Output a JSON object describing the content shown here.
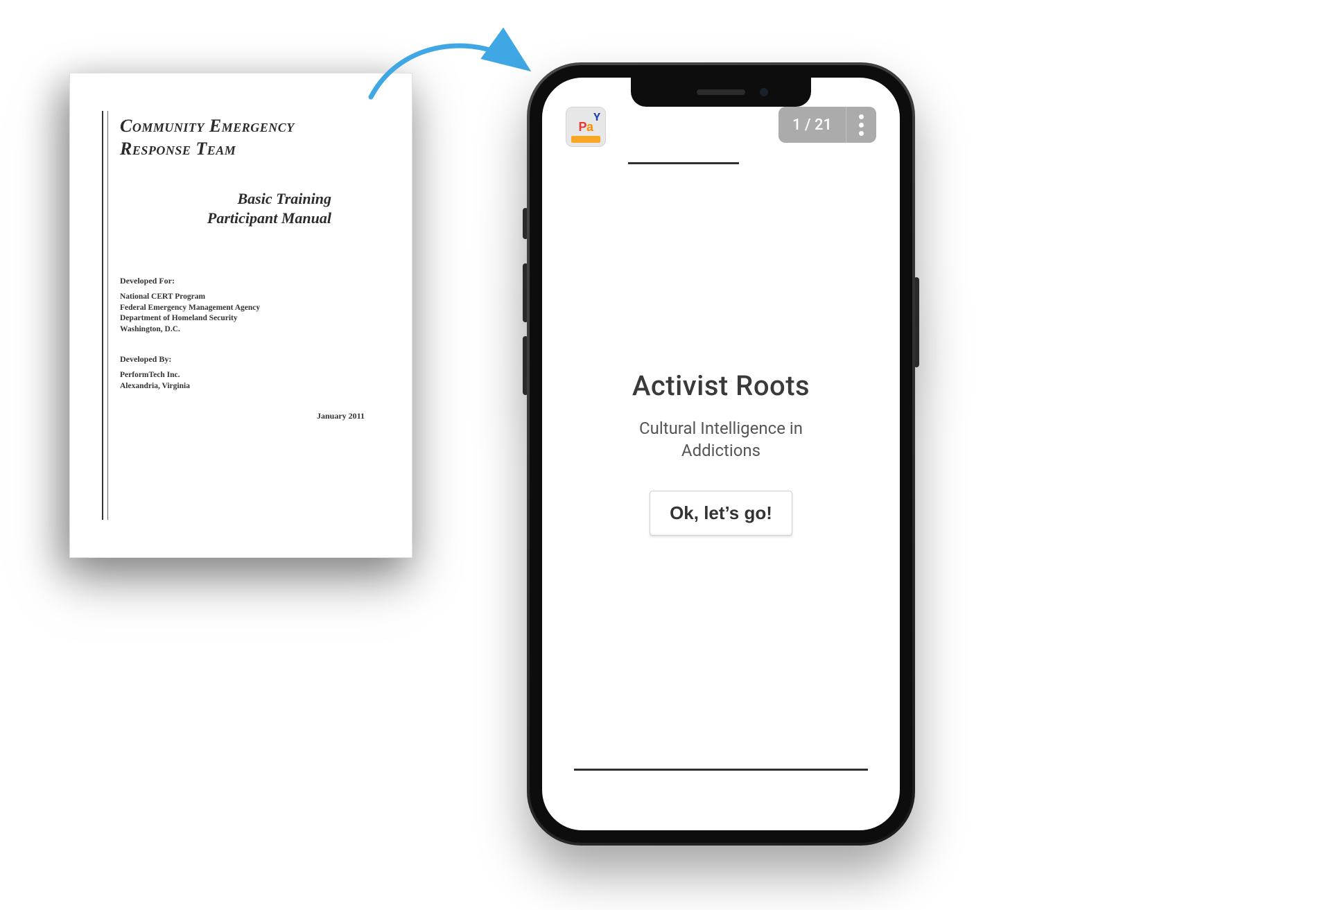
{
  "document": {
    "title": "Community Emergency\n        Response Team",
    "subtitle": "Basic Training\nParticipant Manual",
    "developed_for_label": "Developed For:",
    "developed_for_body": "National CERT Program\nFederal Emergency Management Agency\nDepartment of Homeland Security\nWashington, D.C.",
    "developed_by_label": "Developed By:",
    "developed_by_body": "PerformTech Inc.\nAlexandria, Virginia",
    "date": "January 2011"
  },
  "phone": {
    "logo_text": "Pa",
    "page_counter": "1 / 21",
    "course_title": "Activist Roots",
    "course_subtitle": "Cultural Intelligence in\nAddictions",
    "cta_label": "Ok, let’s go!",
    "icons": {
      "logo": "pay-logo",
      "menu": "kebab-menu-icon"
    }
  },
  "arrow": {
    "color": "#3fa7e4"
  }
}
